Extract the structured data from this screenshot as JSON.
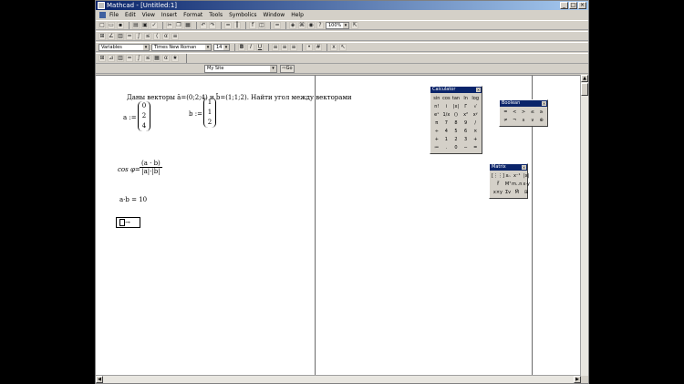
{
  "window": {
    "title": "Mathcad - [Untitled:1]",
    "controls": [
      "_",
      "□",
      "×"
    ]
  },
  "menubar": {
    "items": [
      "File",
      "Edit",
      "View",
      "Insert",
      "Format",
      "Tools",
      "Symbolics",
      "Window",
      "Help"
    ]
  },
  "toolbar": {
    "zoom_value": "100%",
    "style_value": "Variables",
    "font_value": "Times New Roman",
    "size_value": "14",
    "format_buttons": [
      "B",
      "I",
      "U"
    ]
  },
  "resources": {
    "value": "My Site",
    "go_label": "Go"
  },
  "document": {
    "problem_text": "Даны векторы ā=(0;2;4) и b̄=(1;1;2). Найти угол между векторами",
    "a_label": "a :=",
    "a_values": [
      "0",
      "2",
      "4"
    ],
    "b_label": "b :=",
    "b_values": [
      "1",
      "1",
      "2"
    ],
    "cos_label": "cos φ=",
    "cos_numerator": "(a · b)",
    "cos_denominator": "|a|·|b|",
    "dot_result": "a·b = 10",
    "eval_text": "a"
  },
  "palettes": {
    "calculator": {
      "title": "Calculator",
      "buttons": [
        "sin",
        "cos",
        "tan",
        "ln",
        "log",
        "n!",
        "i",
        "|x|",
        "Γ",
        "√",
        "eˣ",
        "1/x",
        "()",
        "x²",
        "xʸ",
        "π",
        "7",
        "8",
        "9",
        "/",
        "÷",
        "4",
        "5",
        "6",
        "×",
        "+",
        "1",
        "2",
        "3",
        "+",
        "≔",
        ".",
        "0",
        "−",
        "="
      ]
    },
    "boolean": {
      "title": "Boolean",
      "buttons": [
        "=",
        "<",
        ">",
        "≤",
        "≥",
        "≠",
        "¬",
        "∧",
        "∨",
        "⊕"
      ]
    },
    "matrix": {
      "title": "Matrix",
      "buttons": [
        "[⋮⋮]",
        "xₙ",
        "x⁻¹",
        "|x|",
        "f⃗",
        "Mᵀ",
        "m..n",
        "x·y",
        "x×y",
        "Σv",
        "M⃗",
        "⊞"
      ]
    }
  }
}
